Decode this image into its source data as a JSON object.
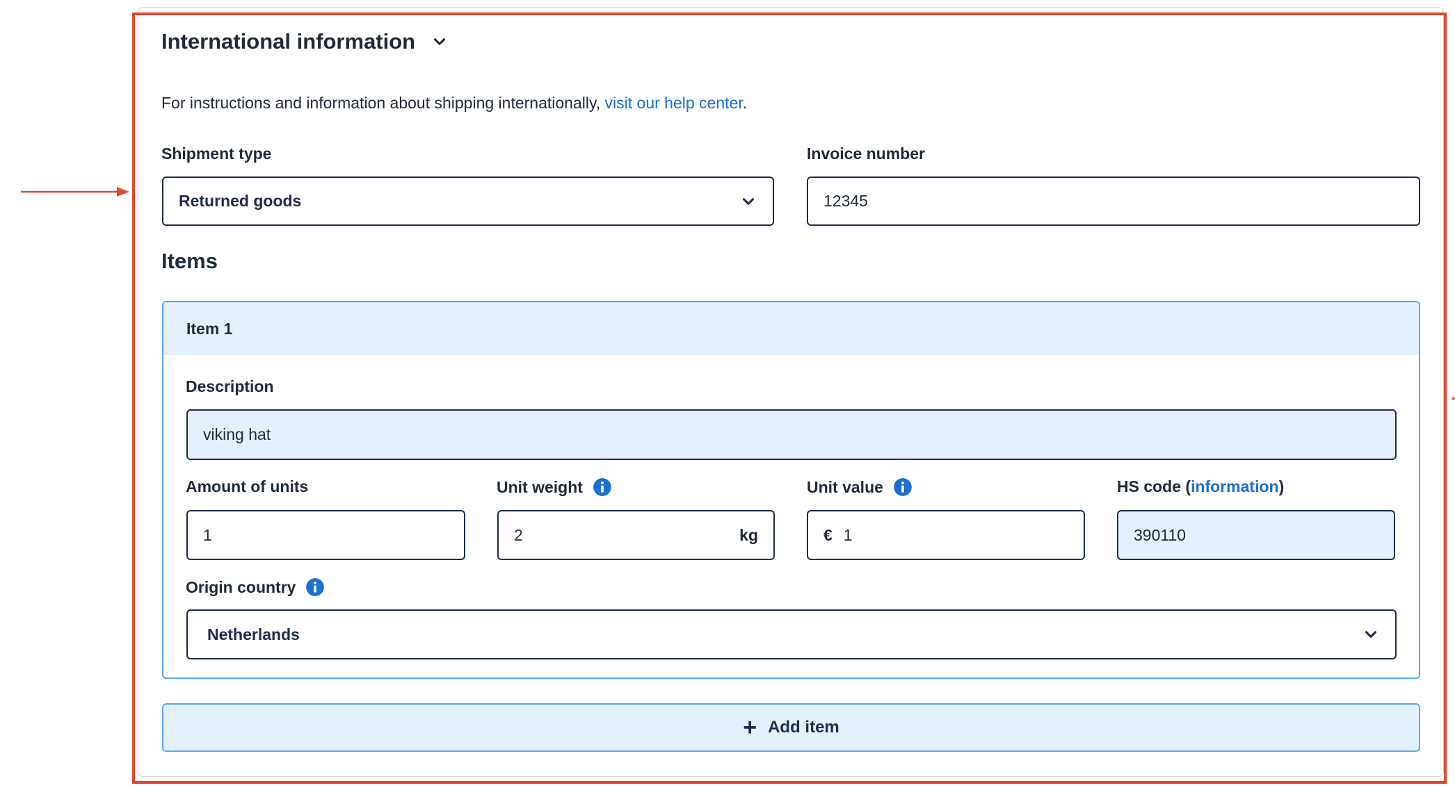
{
  "section": {
    "title": "International information"
  },
  "help": {
    "text": "For instructions and information about shipping internationally, ",
    "link": "visit our help center",
    "end": "."
  },
  "shipment_type": {
    "label": "Shipment type",
    "value": "Returned goods"
  },
  "invoice": {
    "label": "Invoice number",
    "value": "12345"
  },
  "items": {
    "title": "Items",
    "item_1": {
      "title": "Item 1",
      "description": {
        "label": "Description",
        "value": "viking hat"
      },
      "amount": {
        "label": "Amount of units",
        "value": "1"
      },
      "weight": {
        "label": "Unit weight",
        "value": "2",
        "unit": "kg"
      },
      "value": {
        "label": "Unit value",
        "currency": "€",
        "value": "1"
      },
      "hs": {
        "label": "HS code (",
        "link": "information",
        "end": ")",
        "value": "390110"
      },
      "origin": {
        "label": "Origin country",
        "value": "Netherlands"
      }
    }
  },
  "add_item": {
    "label": "Add item"
  },
  "colors": {
    "accent": "#1a6fd1",
    "highlight": "#e0492e",
    "card_border": "#5ba7f2",
    "card_tint": "#e4f1fd",
    "input_border": "#1e2b4f"
  }
}
